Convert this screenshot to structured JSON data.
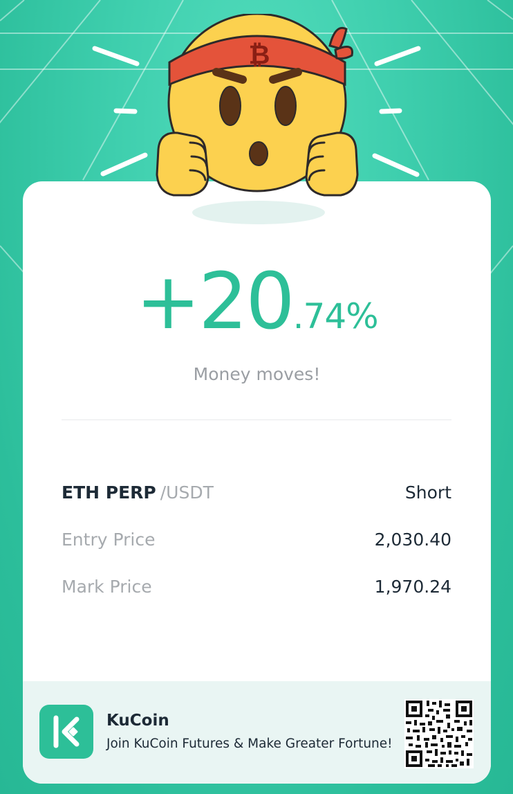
{
  "result": {
    "pnl_integer": "+20",
    "pnl_decimal": ".74%",
    "tagline": "Money moves!"
  },
  "position": {
    "pair_base": "ETH PERP",
    "pair_quote": "/USDT",
    "side": "Short",
    "entry_label": "Entry Price",
    "entry_value": "2,030.40",
    "mark_label": "Mark Price",
    "mark_value": "1,970.24"
  },
  "footer": {
    "brand": "KuCoin",
    "promo": "Join KuCoin Futures & Make Greater Fortune!"
  },
  "icons": {
    "mascot": "bitcoin-headband-emoji-icon",
    "logo": "kucoin-logo-icon",
    "qr": "qr-code-icon"
  },
  "colors": {
    "accent": "#2dbf98",
    "background": "#3fcfae",
    "text_primary": "#1d2a36",
    "text_muted": "#a6aaae",
    "footer_bg": "#e9f5f3"
  }
}
